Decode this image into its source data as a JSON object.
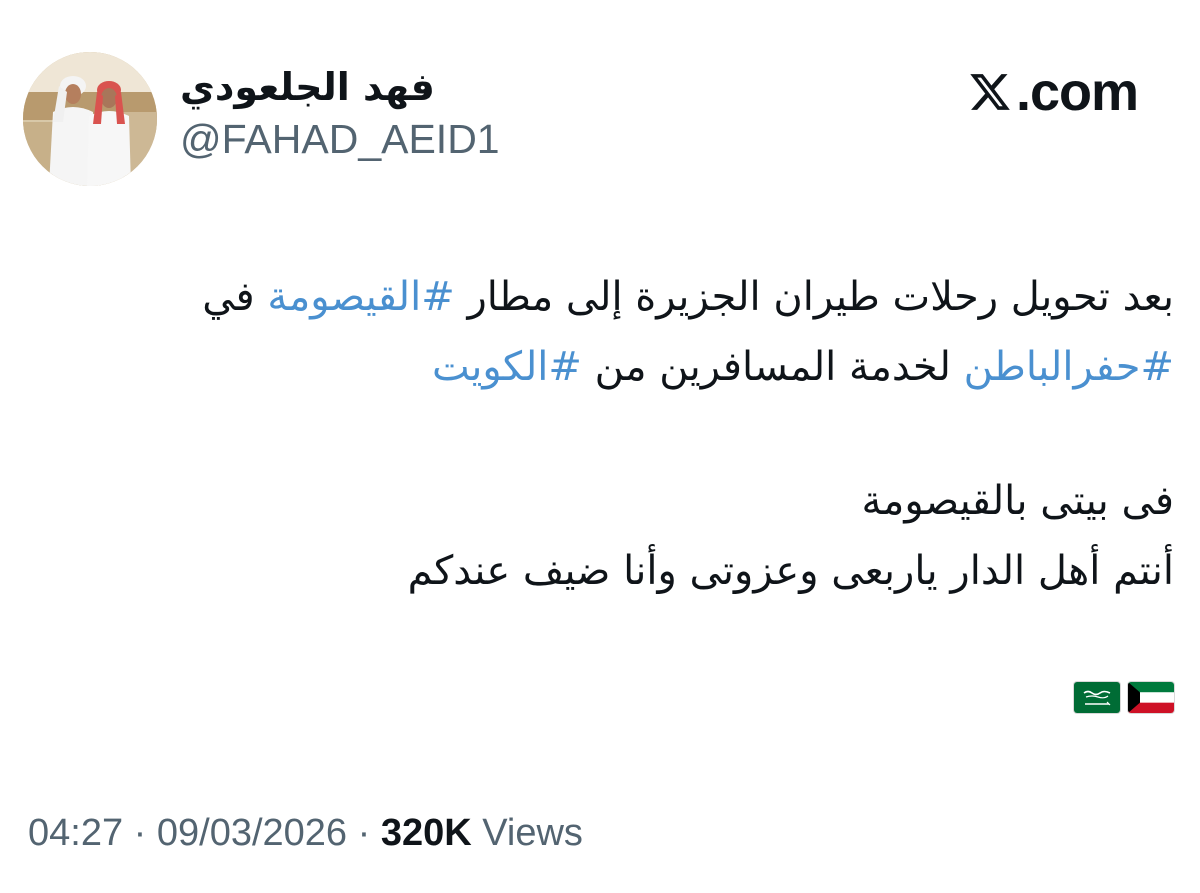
{
  "author": {
    "display_name": "فهد الجلعودي",
    "handle": "@FAHAD_AEID1"
  },
  "brand": {
    "icon": "x-logo-icon",
    "text": ".com"
  },
  "tweet": {
    "line1": {
      "pre": "بعد تحويل رحلات طيران الجزيرة إلى مطار ",
      "hashtag": "#القيصومة",
      "post": " في"
    },
    "line2": {
      "hashtag1": "#حفرالباطن",
      "middle": " لخدمة المسافرين من ",
      "hashtag2": "#الكويت"
    },
    "line3": "فى بيتى بالقيصومة",
    "line4": "أنتم أهل الدار  ياربعى وعزوتى وأنا ضيف عندكم",
    "flags": [
      "kuwait-flag-icon",
      "saudi-flag-icon"
    ]
  },
  "meta": {
    "time": "04:27",
    "separator": " · ",
    "date": "09/03/2026",
    "views_count": "320K",
    "views_label": " Views"
  },
  "colors": {
    "hashtag": "#4a90d0",
    "text": "#0f1419",
    "muted": "#536471"
  }
}
